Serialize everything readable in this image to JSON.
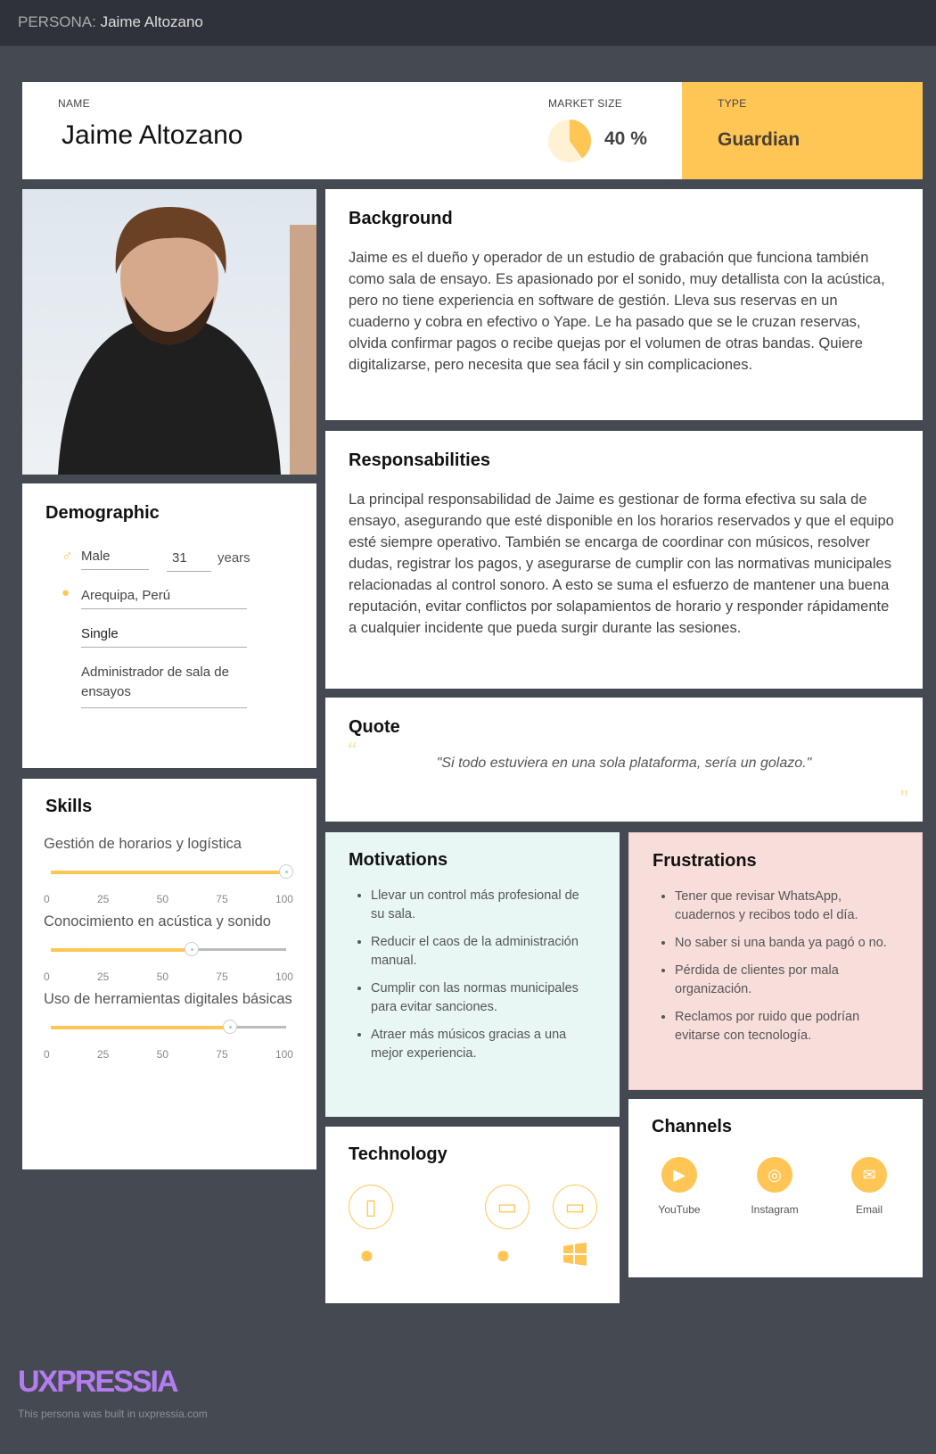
{
  "header": {
    "label": "PERSONA:",
    "name": "Jaime Altozano"
  },
  "profile": {
    "name_label": "NAME",
    "name": "Jaime Altozano",
    "market_label": "MARKET SIZE",
    "market_value": "40 %",
    "market_fraction": 0.4,
    "type_label": "TYPE",
    "type": "Guardian"
  },
  "background": {
    "title": "Background",
    "text": "Jaime es el dueño y operador de un estudio de grabación que funciona también como sala de ensayo. Es apasionado por el sonido, muy detallista con la acústica, pero no tiene experiencia en software de gestión. Lleva sus reservas en un cuaderno y cobra en efectivo o Yape. Le ha pasado que se le cruzan reservas, olvida confirmar pagos o recibe quejas por el volumen de otras bandas. Quiere digitalizarse, pero necesita que sea fácil y sin complicaciones."
  },
  "responsibilities": {
    "title": "Responsabilities",
    "text": "La principal responsabilidad de Jaime es gestionar de forma efectiva su sala de ensayo, asegurando que esté disponible en los horarios reservados y que el equipo esté siempre operativo. También se encarga de coordinar con músicos, resolver dudas, registrar los pagos, y asegurarse de cumplir con las normativas municipales relacionadas al control sonoro. A esto se suma el esfuerzo de mantener una buena reputación, evitar conflictos por solapamientos de horario y responder rápidamente a cualquier incidente que pueda surgir durante las sesiones."
  },
  "quote": {
    "title": "Quote",
    "text": "\"Si todo estuviera en una sola plataforma, sería un golazo.\""
  },
  "demographic": {
    "title": "Demographic",
    "gender": "Male",
    "age": "31",
    "age_unit": "years",
    "location": "Arequipa, Perú",
    "status": "Single",
    "occupation": "Administrador de sala de ensayos"
  },
  "skills": {
    "title": "Skills",
    "ticks": [
      "0",
      "25",
      "50",
      "75",
      "100"
    ],
    "items": [
      {
        "label": "Gestión de horarios y logística",
        "value": 100
      },
      {
        "label": "Conocimiento en acústica y sonido",
        "value": 60
      },
      {
        "label": "Uso de herramientas digitales básicas",
        "value": 76
      }
    ]
  },
  "motivations": {
    "title": "Motivations",
    "items": [
      "Llevar un control más profesional de su sala.",
      "Reducir el caos de la administración manual.",
      "Cumplir con las normas municipales para evitar sanciones.",
      "Atraer más músicos gracias a una mejor experiencia."
    ]
  },
  "frustrations": {
    "title": "Frustrations",
    "items": [
      "Tener que revisar WhatsApp, cuadernos y recibos todo el día.",
      "No saber si una banda ya pagó o no.",
      "Pérdida de clientes por mala organización.",
      "Reclamos por ruido que podrían evitarse con tecnología."
    ]
  },
  "technology": {
    "title": "Technology"
  },
  "channels": {
    "title": "Channels",
    "items": [
      "YouTube",
      "Instagram",
      "Email"
    ]
  },
  "footer": {
    "logo": "UXPRESSIA",
    "note": "This persona was built in uxpressia.com"
  },
  "colors": {
    "accent": "#ffc656",
    "motivations_bg": "#e8f7f3",
    "frustrations_bg": "#f8dedb"
  }
}
